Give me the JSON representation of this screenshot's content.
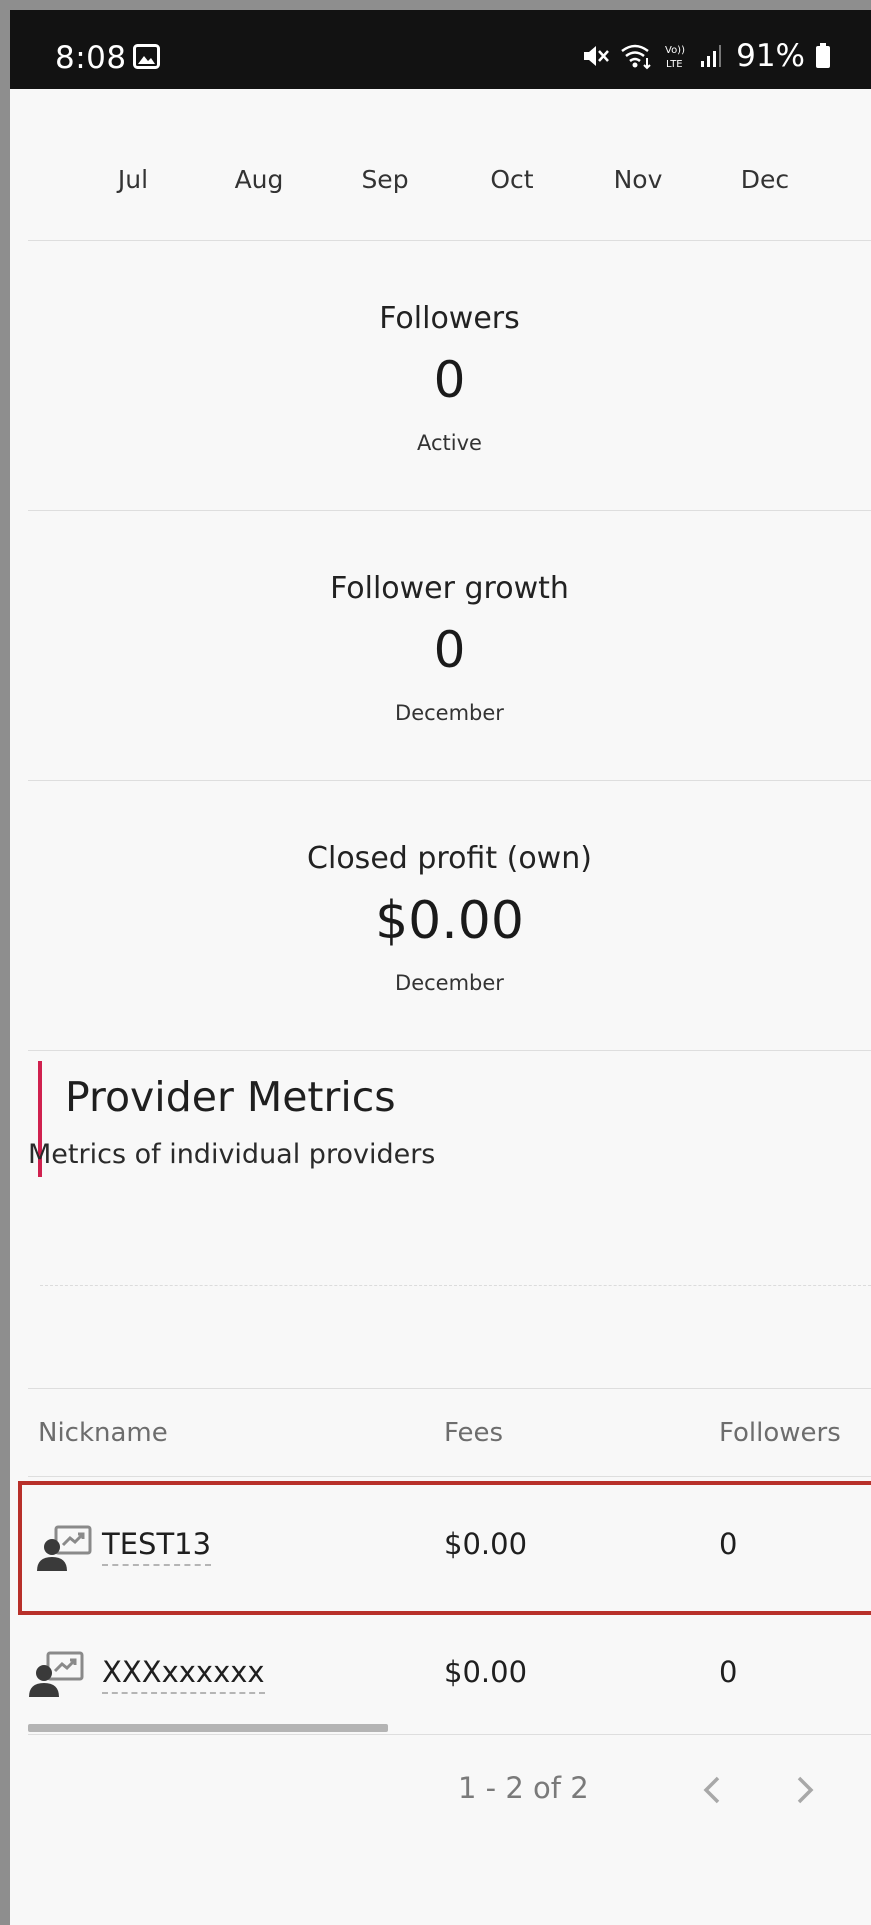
{
  "status_bar": {
    "time": "8:08",
    "battery_percent": "91%",
    "icons": [
      "gallery-icon",
      "mute-icon",
      "wifi-icon",
      "volte-icon",
      "signal-icon",
      "battery-icon"
    ]
  },
  "months": [
    "Jul",
    "Aug",
    "Sep",
    "Oct",
    "Nov",
    "Dec"
  ],
  "stats": [
    {
      "label": "Followers",
      "value": "0",
      "sub": "Active"
    },
    {
      "label": "Follower growth",
      "value": "0",
      "sub": "December"
    },
    {
      "label": "Closed profit (own)",
      "value": "$0.00",
      "sub": "December"
    }
  ],
  "provider_section": {
    "title": "Provider Metrics",
    "subtitle": "Metrics of individual providers",
    "accent_color": "#d0214f"
  },
  "table": {
    "columns": [
      "Nickname",
      "Fees",
      "Followers"
    ],
    "rows": [
      {
        "nickname": "TEST13",
        "fees": "$0.00",
        "followers": "0",
        "highlighted": true
      },
      {
        "nickname": "XXXxxxxxx",
        "fees": "$0.00",
        "followers": "0",
        "highlighted": false
      }
    ],
    "pagination": "1 - 2 of 2",
    "highlight_color": "#b8302a"
  }
}
